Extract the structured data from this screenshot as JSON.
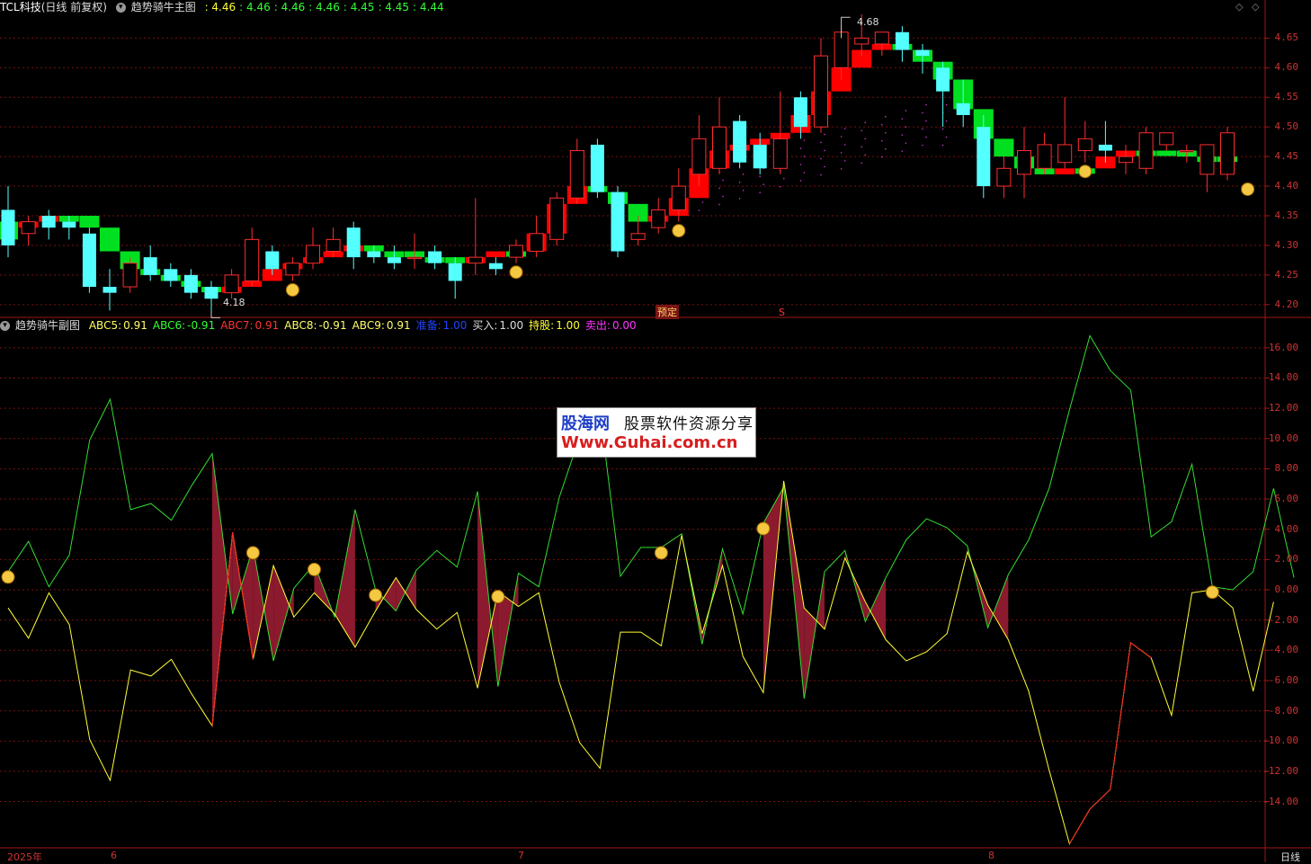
{
  "header_main": {
    "symbol": "TCL科技",
    "period_label": "(日线 前复权)",
    "indicator": "趋势骑牛主图",
    "values": [
      ": 4.46",
      ": 4.46",
      ": 4.46",
      ": 4.46",
      ": 4.45",
      ": 4.45",
      ": 4.44"
    ]
  },
  "header_sub": {
    "indicator": "趋势骑牛副图",
    "items": [
      {
        "label": "ABC5:",
        "value": "0.91",
        "color": "#ffff66"
      },
      {
        "label": "ABC6:",
        "value": "-0.91",
        "color": "#33ff33"
      },
      {
        "label": "ABC7:",
        "value": "0.91",
        "color": "#ff3333"
      },
      {
        "label": "ABC8:",
        "value": "-0.91",
        "color": "#ffff66"
      },
      {
        "label": "ABC9:",
        "value": "0.91",
        "color": "#ffff66"
      },
      {
        "label": "准备:",
        "value": "1.00",
        "color": "#2244ff"
      },
      {
        "label": "买入:",
        "value": "1.00",
        "color": "#dddddd"
      },
      {
        "label": "持股:",
        "value": "1.00",
        "color": "#ffff33"
      },
      {
        "label": "卖出:",
        "value": "0.00",
        "color": "#ff33ff"
      }
    ]
  },
  "price_axis": [
    "4.65",
    "4.60",
    "4.55",
    "4.50",
    "4.45",
    "4.40",
    "4.35",
    "4.30",
    "4.25",
    "4.20"
  ],
  "osc_axis": [
    "16.00",
    "14.00",
    "12.00",
    "10.00",
    "8.00",
    "6.00",
    "4.00",
    "2.00",
    "0.00",
    "-2.00",
    "-4.00",
    "-6.00",
    "-8.00",
    "-10.00",
    "-12.00",
    "-14.00"
  ],
  "x_labels": [
    "2025年",
    "6",
    "7",
    "8"
  ],
  "period": "日线",
  "annotations": {
    "high": "4.68",
    "low": "4.18",
    "yuding": "预定",
    "sell_marker": "S"
  },
  "watermark": {
    "brand": "股海网",
    "tagline": "股票软件资源分享",
    "url": "Www.Guhai.com.cn"
  },
  "colors": {
    "up": "#ff2d2d",
    "down": "#54ffff",
    "bull_band": "#ff0000",
    "bear_band": "#00e020",
    "ma": "#ff33ff",
    "fill": "#8b1a2e",
    "grid": "#7a1010"
  },
  "chart_data": [
    {
      "type": "candlestick",
      "title": "趋势骑牛主图",
      "ylim": [
        4.18,
        4.69
      ],
      "candles": [
        [
          4.36,
          4.3,
          4.4,
          4.28
        ],
        [
          4.32,
          4.34,
          4.35,
          4.3
        ],
        [
          4.35,
          4.33,
          4.36,
          4.31
        ],
        [
          4.34,
          4.33,
          4.35,
          4.31
        ],
        [
          4.32,
          4.23,
          4.33,
          4.22
        ],
        [
          4.23,
          4.22,
          4.26,
          4.19
        ],
        [
          4.23,
          4.27,
          4.28,
          4.22
        ],
        [
          4.28,
          4.25,
          4.3,
          4.24
        ],
        [
          4.26,
          4.24,
          4.27,
          4.23
        ],
        [
          4.25,
          4.22,
          4.26,
          4.21
        ],
        [
          4.23,
          4.21,
          4.24,
          4.18
        ],
        [
          4.22,
          4.25,
          4.26,
          4.21
        ],
        [
          4.24,
          4.31,
          4.33,
          4.23
        ],
        [
          4.29,
          4.26,
          4.3,
          4.25
        ],
        [
          4.25,
          4.27,
          4.28,
          4.24
        ],
        [
          4.27,
          4.3,
          4.33,
          4.26
        ],
        [
          4.29,
          4.31,
          4.33,
          4.28
        ],
        [
          4.33,
          4.28,
          4.34,
          4.26
        ],
        [
          4.29,
          4.28,
          4.3,
          4.27
        ],
        [
          4.28,
          4.27,
          4.3,
          4.26
        ],
        [
          4.28,
          4.28,
          4.32,
          4.26
        ],
        [
          4.29,
          4.27,
          4.3,
          4.26
        ],
        [
          4.27,
          4.24,
          4.28,
          4.21
        ],
        [
          4.27,
          4.28,
          4.38,
          4.25
        ],
        [
          4.27,
          4.26,
          4.28,
          4.25
        ],
        [
          4.28,
          4.3,
          4.31,
          4.27
        ],
        [
          4.29,
          4.32,
          4.35,
          4.28
        ],
        [
          4.31,
          4.38,
          4.39,
          4.3
        ],
        [
          4.38,
          4.46,
          4.48,
          4.37
        ],
        [
          4.47,
          4.39,
          4.48,
          4.38
        ],
        [
          4.39,
          4.29,
          4.4,
          4.28
        ],
        [
          4.31,
          4.32,
          4.35,
          4.3
        ],
        [
          4.33,
          4.36,
          4.38,
          4.32
        ],
        [
          4.36,
          4.4,
          4.43,
          4.34
        ],
        [
          4.42,
          4.48,
          4.52,
          4.4
        ],
        [
          4.43,
          4.5,
          4.55,
          4.42
        ],
        [
          4.51,
          4.44,
          4.52,
          4.43
        ],
        [
          4.47,
          4.43,
          4.49,
          4.42
        ],
        [
          4.43,
          4.48,
          4.56,
          4.42
        ],
        [
          4.55,
          4.5,
          4.56,
          4.48
        ],
        [
          4.5,
          4.62,
          4.65,
          4.49
        ],
        [
          4.6,
          4.66,
          4.67,
          4.58
        ],
        [
          4.64,
          4.65,
          4.69,
          4.62
        ],
        [
          4.64,
          4.66,
          4.66,
          4.62
        ],
        [
          4.66,
          4.63,
          4.67,
          4.61
        ],
        [
          4.63,
          4.62,
          4.64,
          4.59
        ],
        [
          4.6,
          4.56,
          4.61,
          4.5
        ],
        [
          4.54,
          4.52,
          4.58,
          4.5
        ],
        [
          4.5,
          4.4,
          4.52,
          4.38
        ],
        [
          4.4,
          4.43,
          4.45,
          4.38
        ],
        [
          4.42,
          4.46,
          4.5,
          4.38
        ],
        [
          4.43,
          4.47,
          4.49,
          4.42
        ],
        [
          4.44,
          4.47,
          4.55,
          4.43
        ],
        [
          4.46,
          4.48,
          4.51,
          4.44
        ],
        [
          4.47,
          4.46,
          4.51,
          4.44
        ],
        [
          4.44,
          4.45,
          4.47,
          4.42
        ],
        [
          4.43,
          4.49,
          4.5,
          4.42
        ],
        [
          4.47,
          4.49,
          4.49,
          4.46
        ],
        [
          4.46,
          4.46,
          4.47,
          4.44
        ],
        [
          4.42,
          4.47,
          4.47,
          4.39
        ],
        [
          4.42,
          4.49,
          4.5,
          4.41
        ]
      ],
      "trend_band": [
        [
          4.34,
          4.31,
          0
        ],
        [
          4.33,
          4.34,
          1
        ],
        [
          4.34,
          4.35,
          1
        ],
        [
          4.35,
          4.34,
          0
        ],
        [
          4.35,
          4.33,
          0
        ],
        [
          4.33,
          4.29,
          0
        ],
        [
          4.29,
          4.26,
          0
        ],
        [
          4.26,
          4.25,
          0
        ],
        [
          4.25,
          4.24,
          0
        ],
        [
          4.24,
          4.23,
          0
        ],
        [
          4.23,
          4.23,
          0
        ],
        [
          4.22,
          4.23,
          1
        ],
        [
          4.23,
          4.24,
          1
        ],
        [
          4.24,
          4.26,
          1
        ],
        [
          4.26,
          4.27,
          1
        ],
        [
          4.27,
          4.28,
          1
        ],
        [
          4.28,
          4.29,
          1
        ],
        [
          4.29,
          4.3,
          1
        ],
        [
          4.3,
          4.29,
          0
        ],
        [
          4.29,
          4.28,
          0
        ],
        [
          4.29,
          4.28,
          0
        ],
        [
          4.28,
          4.28,
          0
        ],
        [
          4.28,
          4.27,
          0
        ],
        [
          4.27,
          4.28,
          1
        ],
        [
          4.28,
          4.29,
          1
        ],
        [
          4.29,
          4.29,
          0
        ],
        [
          4.29,
          4.32,
          1
        ],
        [
          4.32,
          4.37,
          1
        ],
        [
          4.37,
          4.4,
          1
        ],
        [
          4.4,
          4.39,
          0
        ],
        [
          4.39,
          4.37,
          0
        ],
        [
          4.37,
          4.34,
          0
        ],
        [
          4.34,
          4.35,
          1
        ],
        [
          4.35,
          4.38,
          1
        ],
        [
          4.38,
          4.43,
          1
        ],
        [
          4.43,
          4.46,
          1
        ],
        [
          4.46,
          4.47,
          1
        ],
        [
          4.47,
          4.48,
          1
        ],
        [
          4.48,
          4.49,
          1
        ],
        [
          4.49,
          4.52,
          1
        ],
        [
          4.52,
          4.56,
          1
        ],
        [
          4.56,
          4.6,
          1
        ],
        [
          4.6,
          4.63,
          1
        ],
        [
          4.63,
          4.64,
          1
        ],
        [
          4.64,
          4.63,
          0
        ],
        [
          4.63,
          4.61,
          0
        ],
        [
          4.61,
          4.58,
          0
        ],
        [
          4.58,
          4.53,
          0
        ],
        [
          4.53,
          4.48,
          0
        ],
        [
          4.48,
          4.45,
          0
        ],
        [
          4.45,
          4.43,
          0
        ],
        [
          4.43,
          4.42,
          0
        ],
        [
          4.42,
          4.43,
          1
        ],
        [
          4.43,
          4.43,
          0
        ],
        [
          4.43,
          4.45,
          1
        ],
        [
          4.45,
          4.46,
          1
        ],
        [
          4.46,
          4.46,
          0
        ],
        [
          4.46,
          4.46,
          0
        ],
        [
          4.46,
          4.45,
          0
        ],
        [
          4.45,
          4.45,
          0
        ],
        [
          4.45,
          4.45,
          0
        ]
      ],
      "ma": [
        4.29,
        4.29,
        4.3,
        4.3,
        4.3,
        null,
        null,
        null,
        null,
        null,
        null,
        null,
        null,
        null,
        null,
        null,
        null,
        null,
        null,
        null,
        null,
        null,
        null,
        null,
        null,
        null,
        4.29,
        4.3,
        4.31,
        4.32,
        4.33,
        4.33,
        4.33,
        4.34,
        4.35,
        4.36,
        4.37,
        4.38,
        4.39,
        4.4,
        4.41,
        4.42,
        4.43,
        4.44,
        4.45,
        4.46,
        4.46,
        4.46,
        4.46
      ],
      "signal_bars": [
        14,
        25,
        33,
        53,
        61
      ]
    },
    {
      "type": "line",
      "title": "趋势骑牛副图",
      "ylim": [
        -17,
        17
      ],
      "series": [
        {
          "name": "ABC6",
          "values": [
            1.2,
            3.2,
            0.2,
            2.3,
            9.9,
            12.6,
            5.3,
            5.7,
            4.6,
            6.9,
            9.0,
            -1.6,
            2.8,
            -4.7,
            0.1,
            1.7,
            -1.8,
            5.3,
            0.0,
            -1.4,
            1.3,
            2.6,
            1.5,
            6.5,
            -6.4,
            1.1,
            0.2,
            6.1,
            10.1,
            11.8,
            0.9,
            2.8,
            2.8,
            3.7,
            -3.6,
            2.7,
            -1.6,
            4.4,
            6.8,
            -7.2,
            1.2,
            2.6,
            -2.1,
            0.8,
            3.3,
            4.7,
            4.1,
            2.9,
            -2.5,
            1.0,
            3.3,
            6.7,
            11.9,
            16.8,
            14.5,
            13.2,
            3.5,
            4.5,
            8.3,
            0.2,
            0.0,
            1.2,
            6.7,
            0.8
          ]
        },
        {
          "name": "ABC5",
          "values": [
            -1.2,
            -3.2,
            -0.2,
            -2.3,
            -9.9,
            -12.6,
            -5.3,
            -5.7,
            -4.6,
            -6.9,
            -9.0,
            3.8,
            -4.6,
            1.6,
            -1.8,
            -0.2,
            -1.6,
            -3.8,
            -1.4,
            0.8,
            -1.3,
            -2.6,
            -1.5,
            -6.5,
            -0.1,
            -1.1,
            -0.2,
            -6.1,
            -10.1,
            -11.8,
            -2.8,
            -2.8,
            -3.7,
            3.6,
            -2.9,
            1.6,
            -4.4,
            -6.8,
            7.2,
            -1.2,
            -2.6,
            2.1,
            -0.8,
            -3.3,
            -4.7,
            -4.1,
            -2.9,
            2.5,
            -1.0,
            -3.3,
            -6.7,
            -11.9,
            -16.8,
            -14.5,
            -13.2,
            -3.5,
            -4.5,
            -8.3,
            -0.2,
            0.0,
            -1.2,
            -6.7,
            -0.8
          ]
        }
      ]
    }
  ]
}
